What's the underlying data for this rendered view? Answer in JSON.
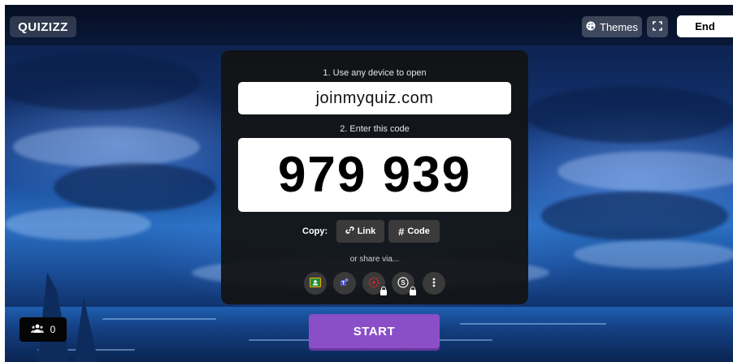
{
  "header": {
    "logo": "QUIZIZZ",
    "themes_label": "Themes",
    "end_label": "End",
    "icons": {
      "themes": "palette-icon",
      "fullscreen": "fullscreen-icon"
    }
  },
  "join_panel": {
    "step1_label": "1. Use any device to open",
    "join_url": "joinmyquiz.com",
    "step2_label": "2. Enter this code",
    "join_code": "979 939",
    "copy_label": "Copy:",
    "copy_link_label": "Link",
    "copy_code_label": "Code",
    "share_label": "or share via...",
    "share_options": [
      {
        "icon": "google-classroom-icon",
        "locked": false
      },
      {
        "icon": "microsoft-teams-icon",
        "locked": false
      },
      {
        "icon": "canvas-icon",
        "locked": true
      },
      {
        "icon": "schoology-icon",
        "locked": true
      },
      {
        "icon": "more-options-icon",
        "locked": false
      }
    ]
  },
  "start_label": "START",
  "player_count": "0",
  "colors": {
    "accent_start": "#8a4fc7",
    "panel_bg": "#121212",
    "button_dark": "#3a3a3a"
  }
}
